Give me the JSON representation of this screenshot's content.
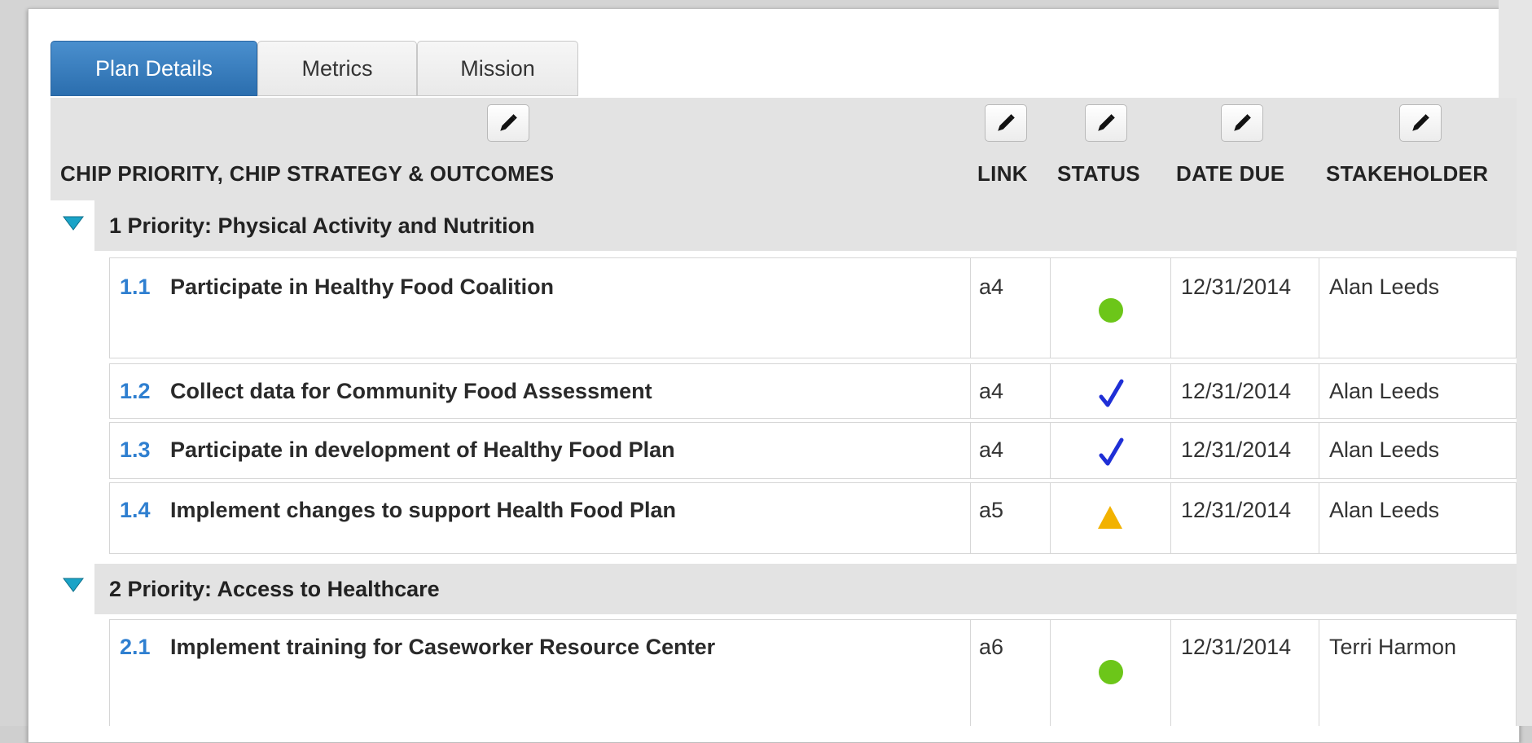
{
  "tabs": [
    {
      "label": "Plan Details",
      "active": true
    },
    {
      "label": "Metrics",
      "active": false
    },
    {
      "label": "Mission",
      "active": false
    }
  ],
  "columns": {
    "outcomes": "CHIP PRIORITY, CHIP STRATEGY & OUTCOMES",
    "link": "LINK",
    "status": "STATUS",
    "date_due": "DATE DUE",
    "stakeholder": "STAKEHOLDER"
  },
  "icons": {
    "edit": "pencil-icon",
    "toggle": "triangle-down-icon",
    "status_on_track": "green-circle-icon",
    "status_complete": "blue-check-icon",
    "status_warning": "yellow-triangle-icon"
  },
  "colors": {
    "tab_active": "#2b6eae",
    "number_blue": "#2f7fd0",
    "toggle_teal": "#1aa3c7",
    "status_green": "#6cc619",
    "status_check": "#1f2fd6",
    "status_warning": "#f2b200"
  },
  "groups": [
    {
      "title": "1 Priority: Physical Activity and Nutrition",
      "rows": [
        {
          "num": "1.1",
          "title": "Participate in Healthy Food Coalition",
          "link": "a4",
          "status": "green-circle-icon",
          "date": "12/31/2014",
          "stakeholder": "Alan Leeds"
        },
        {
          "num": "1.2",
          "title": "Collect data for Community Food Assessment",
          "link": "a4",
          "status": "blue-check-icon",
          "date": "12/31/2014",
          "stakeholder": "Alan Leeds"
        },
        {
          "num": "1.3",
          "title": "Participate in development of Healthy Food Plan",
          "link": "a4",
          "status": "blue-check-icon",
          "date": "12/31/2014",
          "stakeholder": "Alan Leeds"
        },
        {
          "num": "1.4",
          "title": "Implement changes to support Health Food Plan",
          "link": "a5",
          "status": "yellow-triangle-icon",
          "date": "12/31/2014",
          "stakeholder": "Alan Leeds"
        }
      ]
    },
    {
      "title": "2 Priority: Access to Healthcare",
      "rows": [
        {
          "num": "2.1",
          "title": "Implement training for Caseworker Resource Center",
          "link": "a6",
          "status": "green-circle-icon",
          "date": "12/31/2014",
          "stakeholder": "Terri Harmon"
        }
      ]
    }
  ]
}
